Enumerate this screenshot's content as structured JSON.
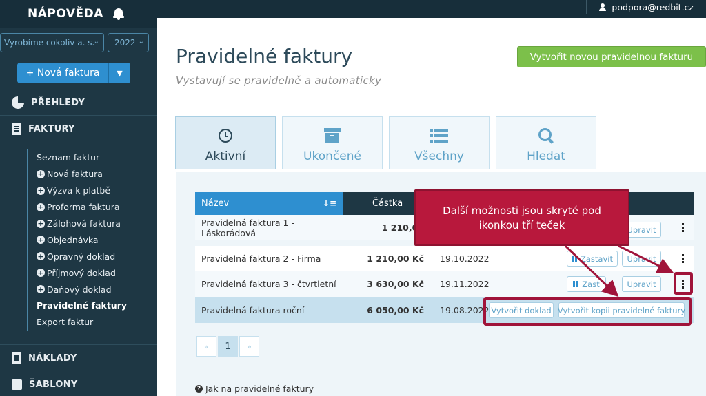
{
  "sidebar": {
    "title": "NÁPOVĚDA",
    "company_select": "Vyrobíme cokoliv a. s.",
    "year_select": "2022",
    "new_invoice_label": "+ Nová faktura",
    "sections": {
      "prehledy": "PŘEHLEDY",
      "faktury": "FAKTURY",
      "naklady": "NÁKLADY",
      "sablony": "ŠABLONY"
    },
    "items": [
      {
        "label": "Seznam faktur",
        "plus": false
      },
      {
        "label": "Nová faktura",
        "plus": true
      },
      {
        "label": "Výzva k platbě",
        "plus": true
      },
      {
        "label": "Proforma faktura",
        "plus": true
      },
      {
        "label": "Zálohová faktura",
        "plus": true
      },
      {
        "label": "Objednávka",
        "plus": true
      },
      {
        "label": "Opravný doklad",
        "plus": true
      },
      {
        "label": "Příjmový doklad",
        "plus": true
      },
      {
        "label": "Daňový doklad",
        "plus": true
      },
      {
        "label": "Pravidelné faktury",
        "plus": false
      },
      {
        "label": "Export faktur",
        "plus": false
      }
    ]
  },
  "topbar": {
    "user_email": "podpora@redbit.cz"
  },
  "page": {
    "title": "Pravidelné faktury",
    "subtitle": "Vystavují se pravidelně a automaticky",
    "create_button": "Vytvořit novou pravidelnou fakturu"
  },
  "tabs": [
    {
      "label": "Aktivní",
      "icon": "clock-icon",
      "active": true
    },
    {
      "label": "Ukončené",
      "icon": "archive-icon",
      "active": false
    },
    {
      "label": "Všechny",
      "icon": "list-icon",
      "active": false
    },
    {
      "label": "Hledat",
      "icon": "search-icon",
      "active": false
    }
  ],
  "table": {
    "headers": {
      "name": "Název",
      "amount": "Částka"
    },
    "rows": [
      {
        "name": "Pravidelná faktura 1 - Láskorádová",
        "amount": "1 210,00",
        "date": ""
      },
      {
        "name": "Pravidelná faktura 2 - Firma",
        "amount": "1 210,00 Kč",
        "date": "19.10.2022"
      },
      {
        "name": "Pravidelná faktura 3 - čtvrtletní",
        "amount": "3 630,00 Kč",
        "date": "19.11.2022"
      },
      {
        "name": "Pravidelná faktura roční",
        "amount": "6 050,00 Kč",
        "date": "19.08.2022"
      }
    ],
    "actions": {
      "pause": "Zastavit",
      "pause_cut": "Zast",
      "edit": "Upravit",
      "create_doc": "Vytvořit doklad",
      "copy": "Vytvořit kopii pravidelné faktury"
    }
  },
  "pagination": {
    "prev": "«",
    "current": "1",
    "next": "»"
  },
  "help_link": "Jak na pravidelné faktury",
  "annotation": {
    "text_line1": "Další možnosti jsou skryté pod",
    "text_line2": "ikonkou tří teček"
  },
  "colors": {
    "sidebar_bg": "#1e3744",
    "accent_blue": "#2e8fd0",
    "create_green": "#7cc04a",
    "annotation_red": "#b8183c"
  }
}
